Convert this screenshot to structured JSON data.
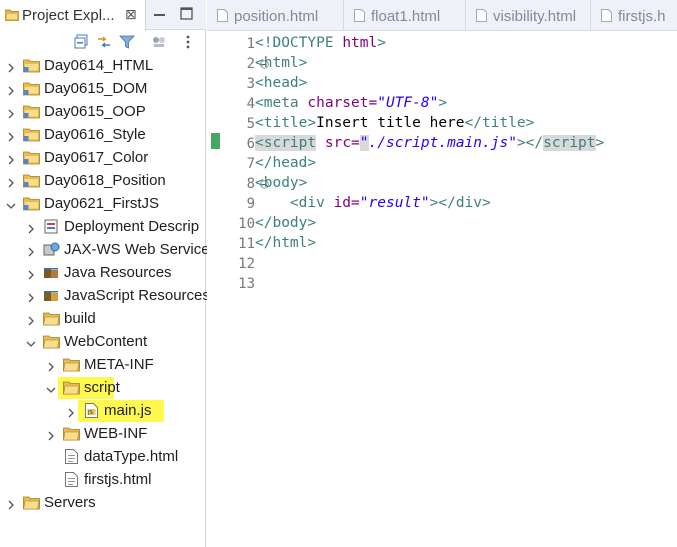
{
  "explorer": {
    "tab_title": "Project Expl...",
    "close_glyph": "⊠",
    "icons": [
      "project-explorer-icon",
      "collapse-all-icon",
      "link-with-editor-icon",
      "filter-icon",
      "focus-icon",
      "view-menu-icon"
    ],
    "tree": [
      {
        "label": "Day0614_HTML",
        "depth": 0,
        "expanded": false,
        "icon": "project-folder-icon"
      },
      {
        "label": "Day0615_DOM",
        "depth": 0,
        "expanded": false,
        "icon": "project-folder-icon"
      },
      {
        "label": "Day0615_OOP",
        "depth": 0,
        "expanded": false,
        "icon": "project-folder-icon"
      },
      {
        "label": "Day0616_Style",
        "depth": 0,
        "expanded": false,
        "icon": "project-folder-icon"
      },
      {
        "label": "Day0617_Color",
        "depth": 0,
        "expanded": false,
        "icon": "project-folder-icon"
      },
      {
        "label": "Day0618_Position",
        "depth": 0,
        "expanded": false,
        "icon": "project-folder-icon"
      },
      {
        "label": "Day0621_FirstJS",
        "depth": 0,
        "expanded": true,
        "icon": "project-folder-icon"
      },
      {
        "label": "Deployment Descrip",
        "depth": 1,
        "expanded": false,
        "icon": "deployment-descriptor-icon"
      },
      {
        "label": "JAX-WS Web Service",
        "depth": 1,
        "expanded": false,
        "icon": "jaxws-icon"
      },
      {
        "label": "Java Resources",
        "depth": 1,
        "expanded": false,
        "icon": "java-resources-icon"
      },
      {
        "label": "JavaScript Resources",
        "depth": 1,
        "expanded": false,
        "icon": "javascript-resources-icon"
      },
      {
        "label": "build",
        "depth": 1,
        "expanded": false,
        "icon": "folder-icon"
      },
      {
        "label": "WebContent",
        "depth": 1,
        "expanded": true,
        "icon": "folder-icon"
      },
      {
        "label": "META-INF",
        "depth": 2,
        "expanded": false,
        "icon": "folder-icon"
      },
      {
        "label": "script",
        "depth": 2,
        "expanded": true,
        "icon": "folder-icon",
        "highlight": true
      },
      {
        "label": "main.js",
        "depth": 3,
        "expanded": false,
        "icon": "js-file-icon",
        "highlight": true
      },
      {
        "label": "WEB-INF",
        "depth": 2,
        "expanded": false,
        "icon": "folder-icon"
      },
      {
        "label": "dataType.html",
        "depth": 2,
        "leaf": true,
        "icon": "html-file-icon"
      },
      {
        "label": "firstjs.html",
        "depth": 2,
        "leaf": true,
        "icon": "html-file-icon"
      },
      {
        "label": "Servers",
        "depth": 0,
        "expanded": false,
        "icon": "folder-icon"
      }
    ]
  },
  "editor": {
    "tabs": [
      "position.html",
      "float1.html",
      "visibility.html",
      "firstjs.h"
    ],
    "line_numbers": [
      "1",
      "2",
      "3",
      "4",
      "5",
      "6",
      "7",
      "8",
      "9",
      "10",
      "11",
      "12",
      "13"
    ],
    "code": {
      "l1_a": "<!DOCTYPE ",
      "l1_b": "html",
      "l1_c": ">",
      "l2": "<html>",
      "l3": "<head>",
      "l4_a": "<meta ",
      "l4_b": "charset=",
      "l4_c": "\"UTF-8\"",
      "l4_d": ">",
      "l5_a": "<title>",
      "l5_b": "Insert title here",
      "l5_c": "</title>",
      "l6_a": "<",
      "l6_b": "script",
      "l6_c": " src=",
      "l6_d": "\"",
      "l6_e": "./script.main.js\"",
      "l6_f": "></",
      "l6_g": "script",
      "l6_h": ">",
      "l7": "</head>",
      "l8": "<body>",
      "l9_a": "    <div ",
      "l9_b": "id=",
      "l9_c": "\"result\"",
      "l9_d": "></div>",
      "l10": "</body>",
      "l11": "</html>"
    }
  },
  "colors": {
    "highlight": "#fff84e",
    "tag": "#3f7f7f",
    "attribute": "#7f007f",
    "value": "#2a00ff",
    "change_marker": "#46a85e"
  }
}
